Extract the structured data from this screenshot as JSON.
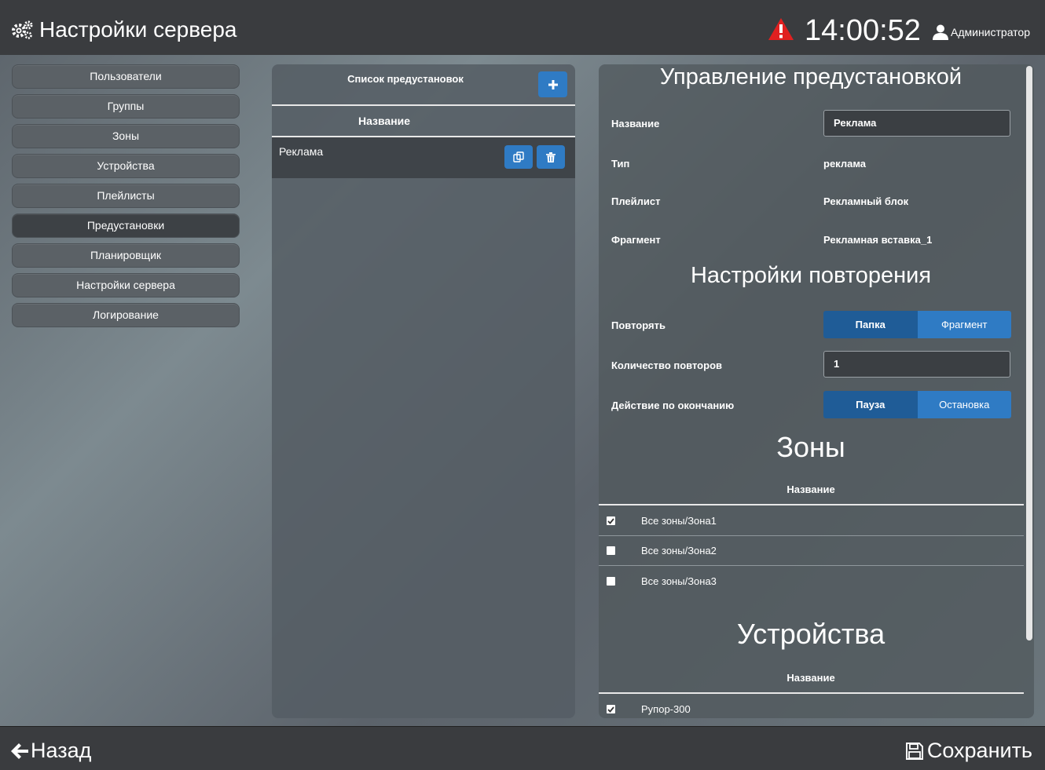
{
  "header": {
    "title": "Настройки сервера",
    "clock": "14:00:52",
    "user": "Администратор"
  },
  "sidebar": {
    "items": [
      {
        "label": "Пользователи"
      },
      {
        "label": "Группы"
      },
      {
        "label": "Зоны"
      },
      {
        "label": "Устройства"
      },
      {
        "label": "Плейлисты"
      },
      {
        "label": "Предустановки",
        "active": true
      },
      {
        "label": "Планировщик"
      },
      {
        "label": "Настройки сервера"
      },
      {
        "label": "Логирование"
      }
    ]
  },
  "presets_list": {
    "title": "Список предустановок",
    "column": "Название",
    "rows": [
      {
        "name": "Реклама"
      }
    ]
  },
  "preset_editor": {
    "title": "Управление предустановкой",
    "name_label": "Название",
    "name_value": "Реклама",
    "type_label": "Тип",
    "type_value": "реклама",
    "playlist_label": "Плейлист",
    "playlist_value": "Рекламный блок",
    "fragment_label": "Фрагмент",
    "fragment_value": "Рекламная вставка_1",
    "repeat_section": "Настройки повторения",
    "repeat_label": "Повторять",
    "repeat_options": [
      "Папка",
      "Фрагмент"
    ],
    "repeat_selected": "Папка",
    "count_label": "Количество повторов",
    "count_value": "1",
    "end_action_label": "Действие по окончанию",
    "end_action_options": [
      "Пауза",
      "Остановка"
    ],
    "end_action_selected": "Пауза",
    "zones_section": "Зоны",
    "zones_column": "Название",
    "zones": [
      {
        "name": "Все зоны/Зона1",
        "checked": true
      },
      {
        "name": "Все зоны/Зона2",
        "checked": false
      },
      {
        "name": "Все зоны/Зона3",
        "checked": false
      }
    ],
    "devices_section": "Устройства",
    "devices_column": "Название",
    "devices": [
      {
        "name": "Рупор-300",
        "checked": true
      }
    ]
  },
  "footer": {
    "back": "Назад",
    "save": "Сохранить"
  },
  "colors": {
    "accent": "#2f7bc4",
    "accent_active": "#1f5c97",
    "alert": "#e02020",
    "bar": "#3a3c3f"
  }
}
